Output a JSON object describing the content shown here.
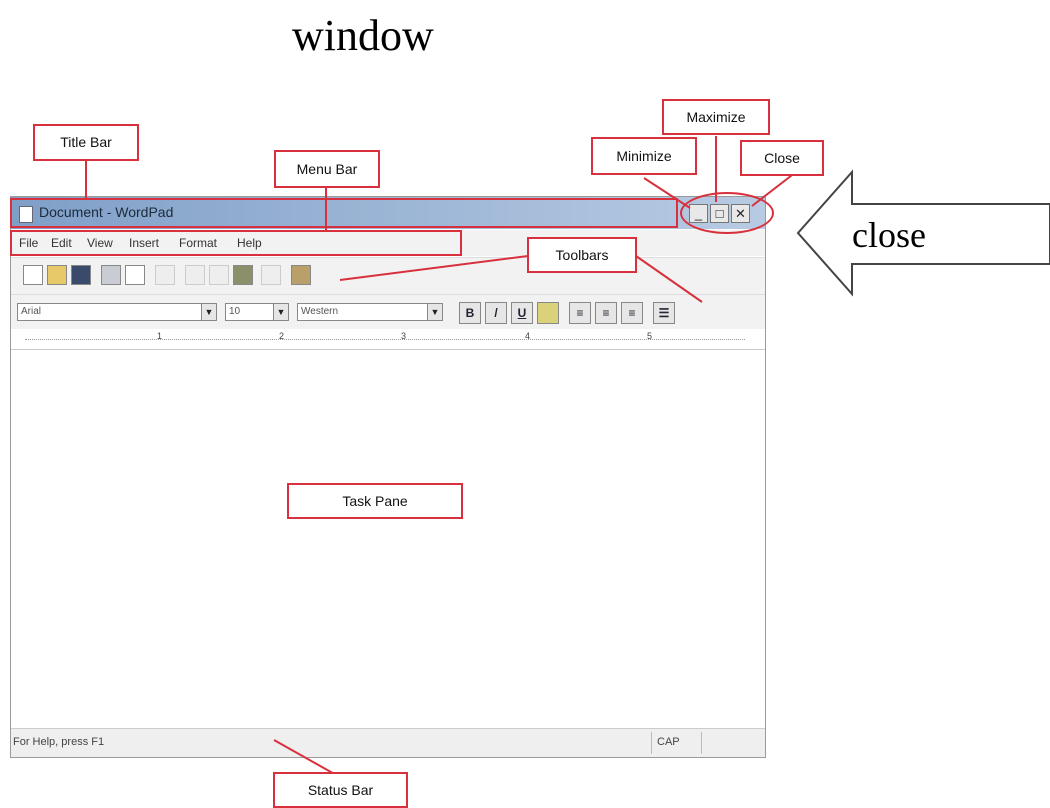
{
  "heading": "window",
  "arrow_label": "close",
  "window": {
    "title": "Document - WordPad",
    "menu": [
      "File",
      "Edit",
      "View",
      "Insert",
      "Format",
      "Help"
    ],
    "font_name": "Arial",
    "font_size": "10",
    "script": "Western",
    "format_buttons": [
      "B",
      "/",
      "U"
    ],
    "ruler_numbers": [
      "1",
      "2",
      "3",
      "4",
      "5"
    ],
    "status_text": "For Help, press F1",
    "status_indicator": "CAP",
    "buttons": {
      "minimize": "_",
      "maximize": "□",
      "close": "✕"
    }
  },
  "callouts": {
    "title_bar": "Title Bar",
    "menu_bar": "Menu Bar",
    "maximize": "Maximize",
    "minimize": "Minimize",
    "close": "Close",
    "toolbars": "Toolbars",
    "task_pane": "Task Pane",
    "status_bar": "Status Bar"
  },
  "colors": {
    "callout_border": "#d8303c",
    "title_bar_gradient_start": "#7f9fc8",
    "title_bar_gradient_end": "#b8cbe3"
  }
}
